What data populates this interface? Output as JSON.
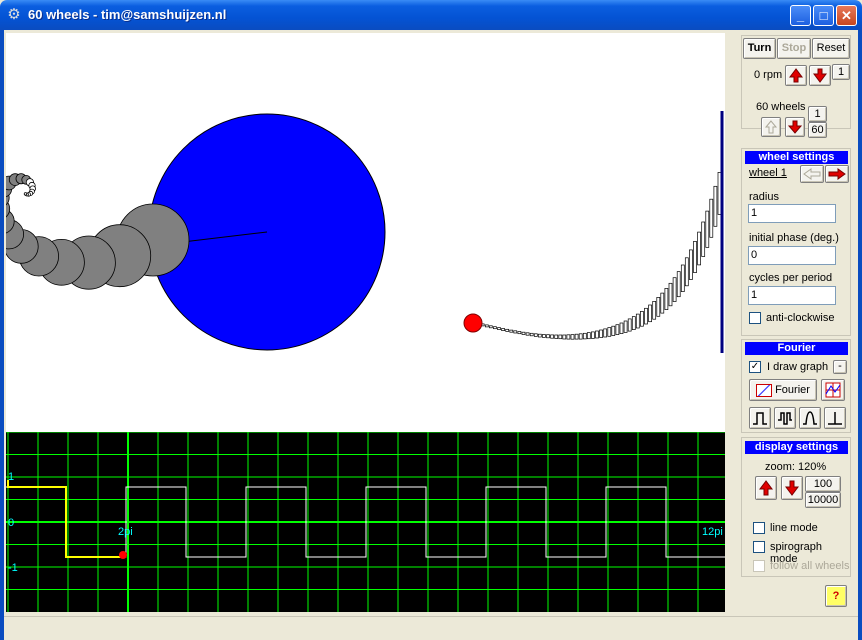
{
  "window": {
    "title": "60 wheels - tim@samshuijzen.nl"
  },
  "controls": {
    "turn_label": "Turn",
    "stop_label": "Stop",
    "reset_label": "Reset",
    "rpm_text": "0 rpm",
    "rpm_step": "1",
    "wheels_text": "60 wheels",
    "wheels_min": "1",
    "wheels_max": "60"
  },
  "wheel_settings": {
    "header": "wheel settings",
    "wheel_link": "wheel 1",
    "radius_label": "radius",
    "radius_value": "1",
    "phase_label": "initial phase (deg.)",
    "phase_value": "0",
    "cycles_label": "cycles per period",
    "cycles_value": "1",
    "anticlockwise_label": "anti-clockwise",
    "anticlockwise_checked": false
  },
  "fourier": {
    "header": "Fourier",
    "draw_graph_label": "I draw graph",
    "draw_graph_checked": true,
    "small_btn": "-",
    "fourier_btn": "Fourier"
  },
  "display_settings": {
    "header": "display settings",
    "zoom_text": "zoom: 120%",
    "zoom_a": "100",
    "zoom_b": "10000",
    "line_mode_label": "line mode",
    "spirograph_label": "spirograph mode",
    "follow_label": "follow all wheels"
  },
  "help_label": "?",
  "graph": {
    "y_label_1": "1",
    "y_label_0": "0",
    "y_label_m1": "-1",
    "x_label_2pi": "2pi",
    "x_label_12pi": "12pi",
    "grid_color": "#00ff00",
    "trace_color": "#ffff00",
    "wave_color": "#ffffff"
  },
  "colors": {
    "big_wheel": "#0000ff",
    "small_wheels": "#808080",
    "marker": "#ff0000",
    "section_header": "#0000ff"
  }
}
